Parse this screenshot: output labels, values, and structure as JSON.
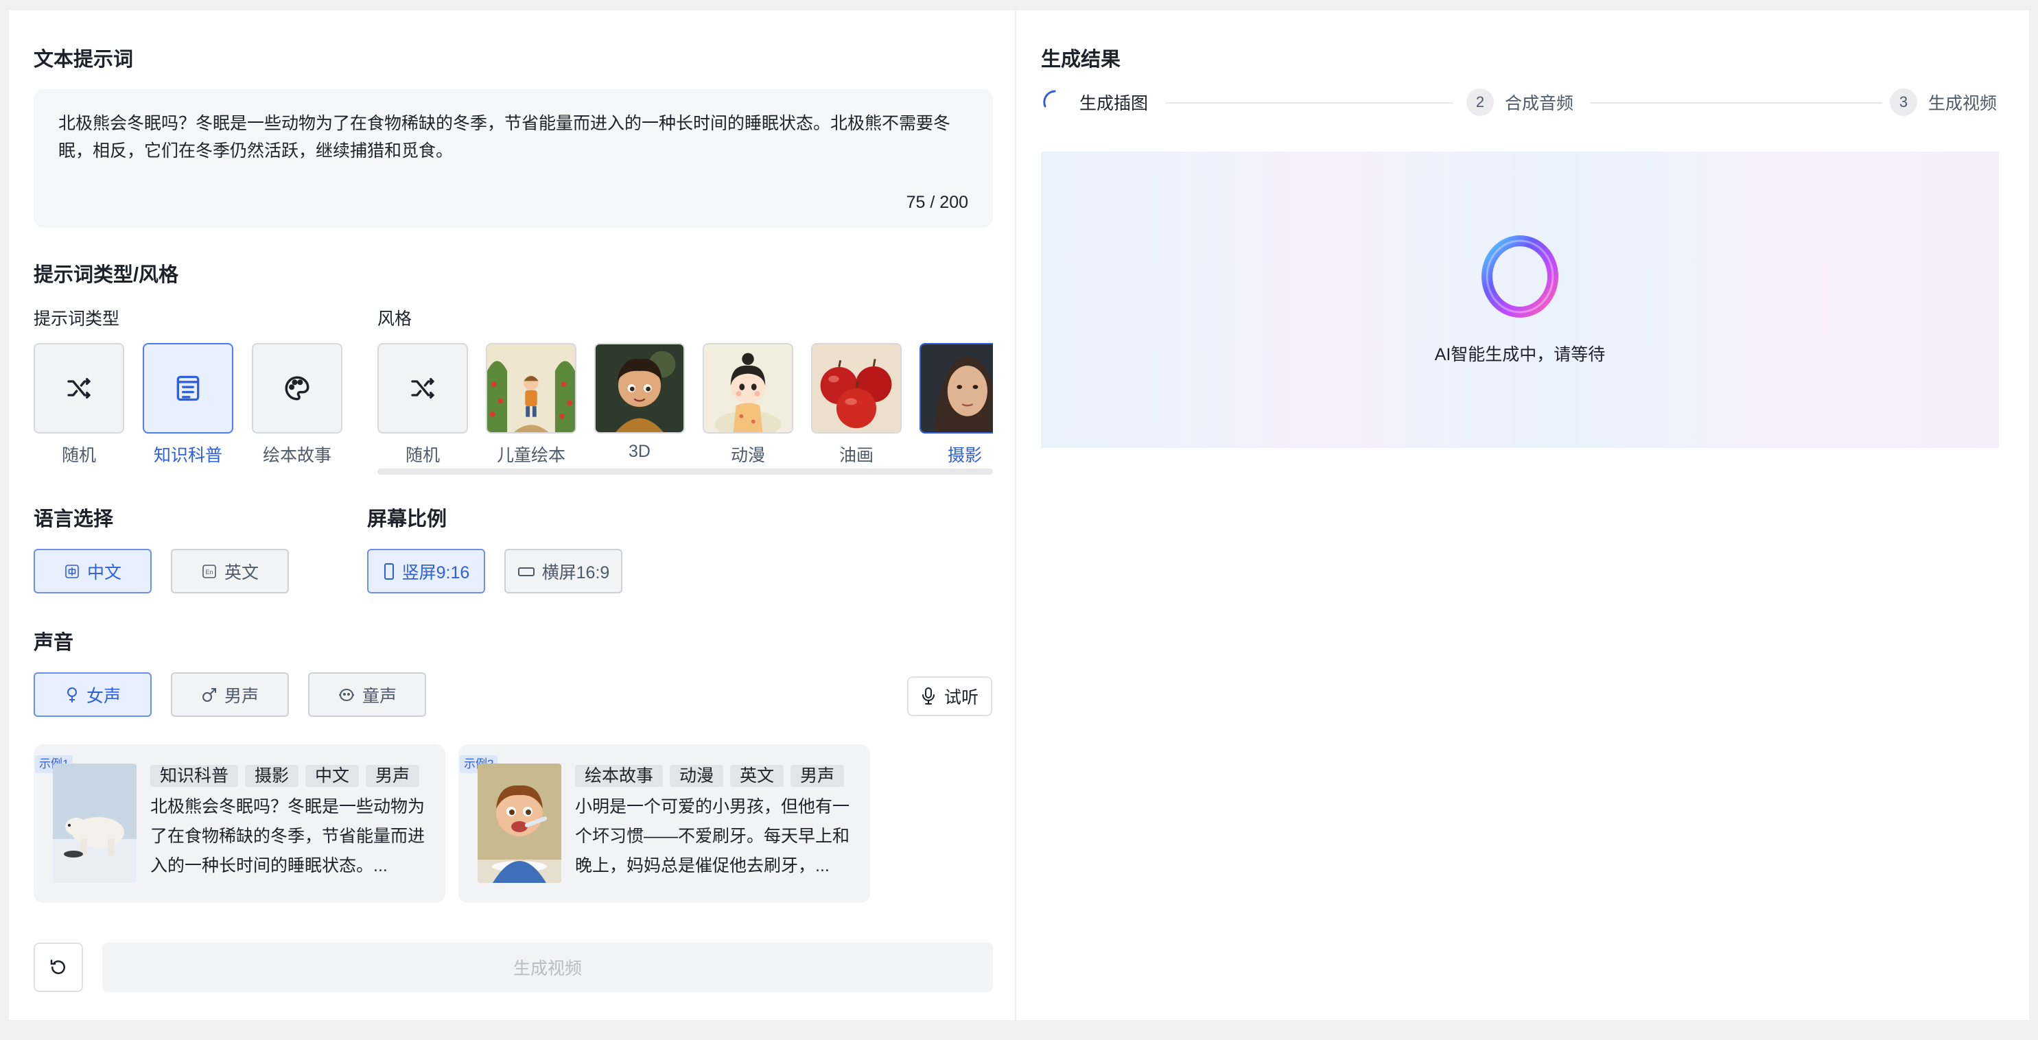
{
  "left": {
    "prompt_section_title": "文本提示词",
    "prompt_text": "北极熊会冬眠吗？冬眠是一些动物为了在食物稀缺的冬季，节省能量而进入的一种长时间的睡眠状态。北极熊不需要冬眠，相反，它们在冬季仍然活跃，继续捕猎和觅食。",
    "prompt_counter": "75 / 200",
    "type_style_title": "提示词类型/风格",
    "prompt_type_label": "提示词类型",
    "prompt_types": [
      {
        "label": "随机",
        "icon": "shuffle-icon",
        "selected": false
      },
      {
        "label": "知识科普",
        "icon": "document-icon",
        "selected": true
      },
      {
        "label": "绘本故事",
        "icon": "palette-icon",
        "selected": false
      }
    ],
    "style_label": "风格",
    "styles": [
      {
        "label": "随机",
        "icon": "shuffle-icon",
        "selected": false
      },
      {
        "label": "儿童绘本",
        "selected": false
      },
      {
        "label": "3D",
        "selected": false
      },
      {
        "label": "动漫",
        "selected": false
      },
      {
        "label": "油画",
        "selected": false
      },
      {
        "label": "摄影",
        "selected": true
      }
    ],
    "language_title": "语言选择",
    "languages": [
      {
        "label": "中文",
        "icon": "zh-icon",
        "selected": true
      },
      {
        "label": "英文",
        "icon": "en-icon",
        "selected": false
      }
    ],
    "ratio_title": "屏幕比例",
    "ratios": [
      {
        "label": "竖屏9:16",
        "icon": "portrait-icon",
        "selected": true
      },
      {
        "label": "横屏16:9",
        "icon": "landscape-icon",
        "selected": false
      }
    ],
    "voice_title": "声音",
    "voices": [
      {
        "label": "女声",
        "icon": "female-icon",
        "selected": true
      },
      {
        "label": "男声",
        "icon": "male-icon",
        "selected": false
      },
      {
        "label": "童声",
        "icon": "child-icon",
        "selected": false
      }
    ],
    "listen_label": "试听",
    "examples": [
      {
        "badge": "示例1",
        "tags": [
          "知识科普",
          "摄影",
          "中文",
          "男声"
        ],
        "text": "北极熊会冬眠吗？冬眠是一些动物为了在食物稀缺的冬季，节省能量而进入的一种长时间的睡眠状态。..."
      },
      {
        "badge": "示例2",
        "tags": [
          "绘本故事",
          "动漫",
          "英文",
          "男声"
        ],
        "text": "小明是一个可爱的小男孩，但他有一个坏习惯——不爱刷牙。每天早上和晚上，妈妈总是催促他去刷牙，..."
      }
    ],
    "generate_label": "生成视频"
  },
  "right": {
    "title": "生成结果",
    "steps": [
      {
        "num": "",
        "label": "生成插图",
        "state": "loading"
      },
      {
        "num": "2",
        "label": "合成音频",
        "state": "pending"
      },
      {
        "num": "3",
        "label": "生成视频",
        "state": "pending"
      }
    ],
    "loading_text": "AI智能生成中，请等待"
  },
  "colors": {
    "accent": "#2f5fdd",
    "accent_bg": "#e8effe",
    "muted": "#4e5969"
  }
}
